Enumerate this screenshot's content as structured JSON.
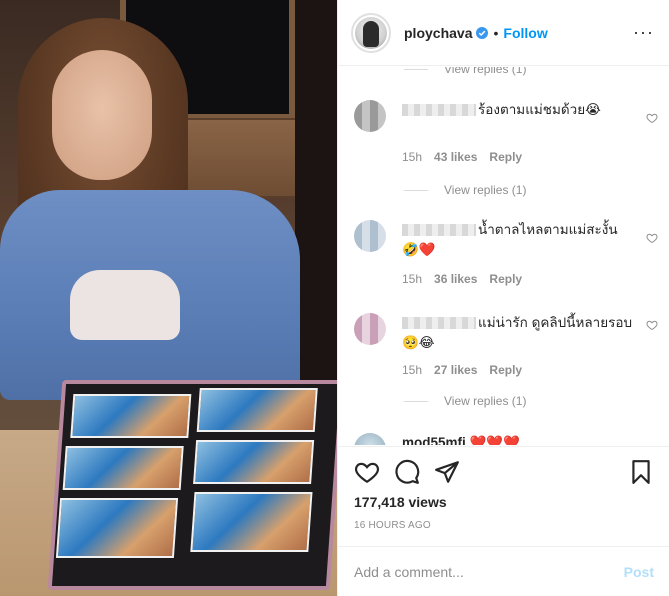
{
  "header": {
    "username": "ploychava",
    "separator": "•",
    "follow_label": "Follow",
    "more": "···"
  },
  "comments": {
    "top_view_replies": "View replies (1)",
    "items": [
      {
        "text": "ร้องตามแม่ชมด้วย😭",
        "time": "15h",
        "likes": "43 likes",
        "reply": "Reply",
        "view_replies": "View replies (1)"
      },
      {
        "text": "น้ำตาลไหลตามแม่สะงั้น 🤣❤️",
        "time": "15h",
        "likes": "36 likes",
        "reply": "Reply"
      },
      {
        "text": "แม่น่ารัก ดูคลิปนี้หลายรอบ 🥺😂",
        "time": "15h",
        "likes": "27 likes",
        "reply": "Reply",
        "view_replies": "View replies (1)"
      },
      {
        "username": "mod55mfi",
        "text": "❤️❤️❤️"
      }
    ]
  },
  "actions": {
    "like_icon": "heart-icon",
    "comment_icon": "comment-icon",
    "share_icon": "share-icon",
    "save_icon": "bookmark-icon"
  },
  "views": "177,418 views",
  "time_ago": "16 HOURS AGO",
  "add_comment": {
    "placeholder": "Add a comment...",
    "post_label": "Post"
  },
  "colors": {
    "accent": "#0095f6",
    "post_disabled": "#b2dffc",
    "muted": "#8e8e8e",
    "heart_red": "#ed4956"
  }
}
